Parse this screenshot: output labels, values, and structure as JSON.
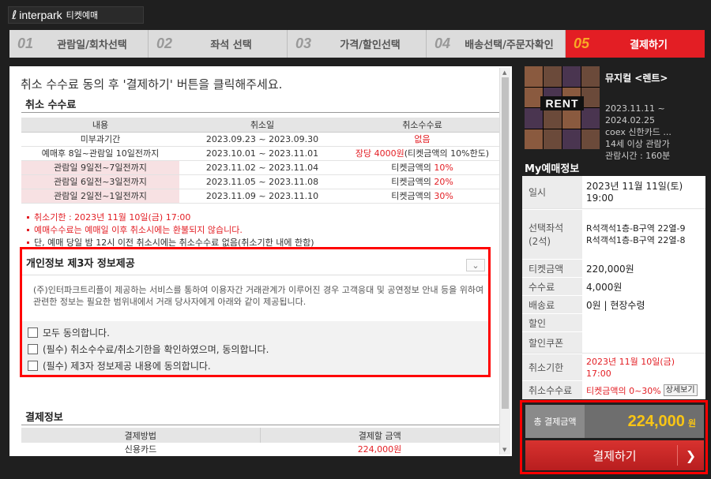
{
  "header": {
    "logo_text": "interpark",
    "logo_sub": "티켓예매"
  },
  "steps": [
    {
      "num": "01",
      "label": "관람일/회차선택"
    },
    {
      "num": "02",
      "label": "좌석 선택"
    },
    {
      "num": "03",
      "label": "가격/할인선택"
    },
    {
      "num": "04",
      "label": "배송선택/주문자확인"
    },
    {
      "num": "05",
      "label": "결제하기"
    }
  ],
  "instruction": "취소 수수료 동의 후 '결제하기' 버튼을 클릭해주세요.",
  "cancel_fee": {
    "title": "취소 수수료",
    "headers": [
      "내용",
      "취소일",
      "취소수수료"
    ],
    "rows": [
      {
        "content": "미부과기간",
        "date": "2023.09.23 ~ 2023.09.30",
        "fee_red": "없음",
        "fee_tail": ""
      },
      {
        "content": "예매후 8일~관람일 10일전까지",
        "date": "2023.10.01 ~ 2023.11.01",
        "fee_red": "장당 4000원",
        "fee_tail": "(티켓금액의 10%한도)"
      },
      {
        "content": "관람일 9일전~7일전까지",
        "date": "2023.11.02 ~ 2023.11.04",
        "fee_pre": "티켓금액의 ",
        "fee_red": "10%"
      },
      {
        "content": "관람일 6일전~3일전까지",
        "date": "2023.11.05 ~ 2023.11.08",
        "fee_pre": "티켓금액의 ",
        "fee_red": "20%"
      },
      {
        "content": "관람일 2일전~1일전까지",
        "date": "2023.11.09 ~ 2023.11.10",
        "fee_pre": "티켓금액의 ",
        "fee_red": "30%"
      }
    ],
    "notes": [
      "취소기한 : 2023년 11월 10일(금) 17:00",
      "예매수수료는 예매일 이후 취소시에는 환불되지 않습니다.",
      "단, 예매 당일 밤 12시 이전 취소시에는 취소수수료 없음(취소기한 내에 한함)"
    ]
  },
  "privacy": {
    "title": "개인정보 제3자 정보제공",
    "text": "(주)인터파크트리플이 제공하는 서비스를 통하여 이용자간 거래관계가 이루어진 경우 고객응대 및 공연정보 안내 등을 위하여 관련한 정보는 필요한 범위내에서 거래 당사자에게 아래와 같이 제공됩니다.",
    "checks": [
      "모두 동의합니다.",
      "(필수) 취소수수료/취소기한을 확인하였으며, 동의합니다.",
      "(필수) 제3자 정보제공 내용에 동의합니다."
    ]
  },
  "payment": {
    "title": "결제정보",
    "headers": [
      "결제방법",
      "결제할 금액"
    ],
    "method": "신용카드",
    "amount": "224,000원"
  },
  "show": {
    "poster_text": "RENT",
    "title": "뮤지컬 <렌트>",
    "period_start": "2023.11.11 ~",
    "period_end": "2024.02.25",
    "venue": "coex 신한카드 ...",
    "age": "14세 이상 관람가",
    "runtime": "관람시간 : 160분"
  },
  "my_info": {
    "title": "My예매정보",
    "date_label": "일시",
    "date_line1": "2023년 11월 11일(토)",
    "date_line2": "19:00",
    "seat_label_1": "선택좌석",
    "seat_label_2": "(2석)",
    "seat_1": "R석객석1층-B구역 22열-9",
    "seat_2": "R석객석1층-B구역 22열-8",
    "ticket_label": "티켓금액",
    "ticket_value": "220,000원",
    "fee_label": "수수료",
    "fee_value": "4,000원",
    "delivery_label": "배송료",
    "delivery_value": "0원 | 현장수령",
    "discount_label": "할인",
    "discount_value": "",
    "coupon_label": "할인쿠폰",
    "coupon_value": "",
    "deadline_label": "취소기한",
    "deadline_line1": "2023년 11월 10일(금)",
    "deadline_line2": "17:00",
    "cancelfee_label": "취소수수료",
    "cancelfee_value": "티켓금액의 0~30%",
    "detail_button": "상세보기"
  },
  "total": {
    "label": "총 결제금액",
    "amount": "224,000",
    "unit": "원"
  },
  "pay_button": "결제하기",
  "colors": {
    "accent": "#e31e24",
    "highlight": "#f9c515",
    "dark": "#1f1f1f"
  }
}
